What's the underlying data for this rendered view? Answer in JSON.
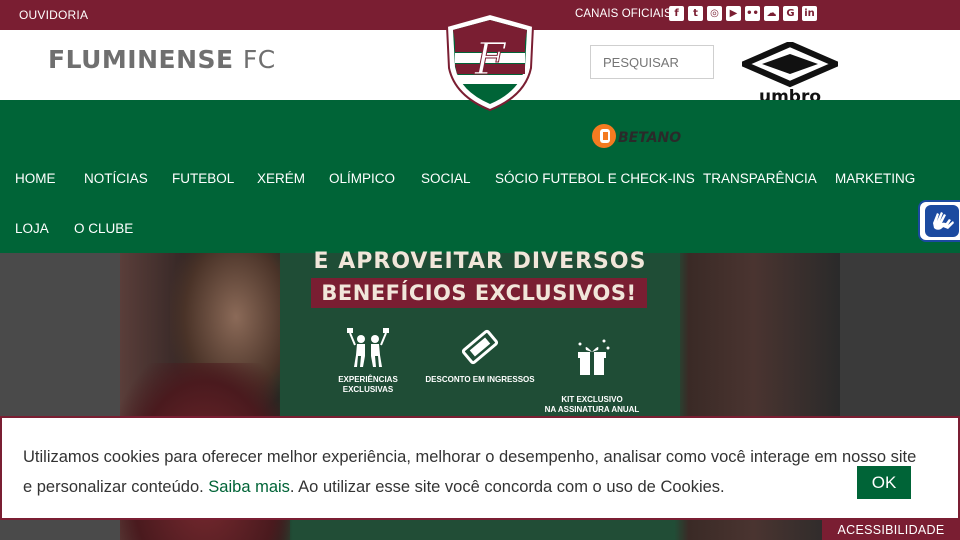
{
  "topbar": {
    "ouvidoria": "OUVIDORIA",
    "canais_label": "CANAIS OFICIAIS",
    "social_icons": [
      {
        "name": "facebook-icon",
        "glyph": "f"
      },
      {
        "name": "twitter-icon",
        "glyph": "t"
      },
      {
        "name": "instagram-icon",
        "glyph": "◎"
      },
      {
        "name": "youtube-icon",
        "glyph": "▶"
      },
      {
        "name": "flickr-icon",
        "glyph": "••"
      },
      {
        "name": "soundcloud-icon",
        "glyph": "☁"
      },
      {
        "name": "google-plus-icon",
        "glyph": "G"
      },
      {
        "name": "linkedin-icon",
        "glyph": "in"
      }
    ]
  },
  "header": {
    "brand_main": "FLUMINENSE",
    "brand_fc": "FC",
    "search_placeholder": "PESQUISAR",
    "sponsor_umbro": "umbro",
    "sponsor_betano": "BETANO"
  },
  "nav": {
    "row1": [
      "HOME",
      "NOTÍCIAS",
      "FUTEBOL",
      "XERÉM",
      "OLÍMPICO",
      "SOCIAL",
      "SÓCIO FUTEBOL E CHECK-INS",
      "TRANSPARÊNCIA",
      "MARKETING"
    ],
    "row2": [
      "LOJA",
      "O CLUBE"
    ]
  },
  "banner": {
    "line1": "E APROVEITAR DIVERSOS",
    "line2": "BENEFÍCIOS EXCLUSIVOS!",
    "benefits": [
      {
        "label": "EXPERIÊNCIAS EXCLUSIVAS",
        "icon": "fans-icon"
      },
      {
        "label": "DESCONTO EM INGRESSOS",
        "icon": "ticket-icon"
      },
      {
        "label": "KIT EXCLUSIVO\nNA ASSINATURA ANUAL",
        "icon": "gift-icon"
      }
    ]
  },
  "cookie": {
    "text_before": "Utilizamos cookies para oferecer melhor experiência, melhorar o desempenho, analisar como você interage em nosso site e personalizar conteúdo. ",
    "link": "Saiba mais",
    "text_after": ". Ao utilizar esse site você concorda com o uso de Cookies.",
    "ok": "OK"
  },
  "accessibility": {
    "label": "ACESSIBILIDADE"
  },
  "colors": {
    "grena": "#7a1e32",
    "green": "#006437",
    "accessibility_blue": "#1b4aa0"
  }
}
